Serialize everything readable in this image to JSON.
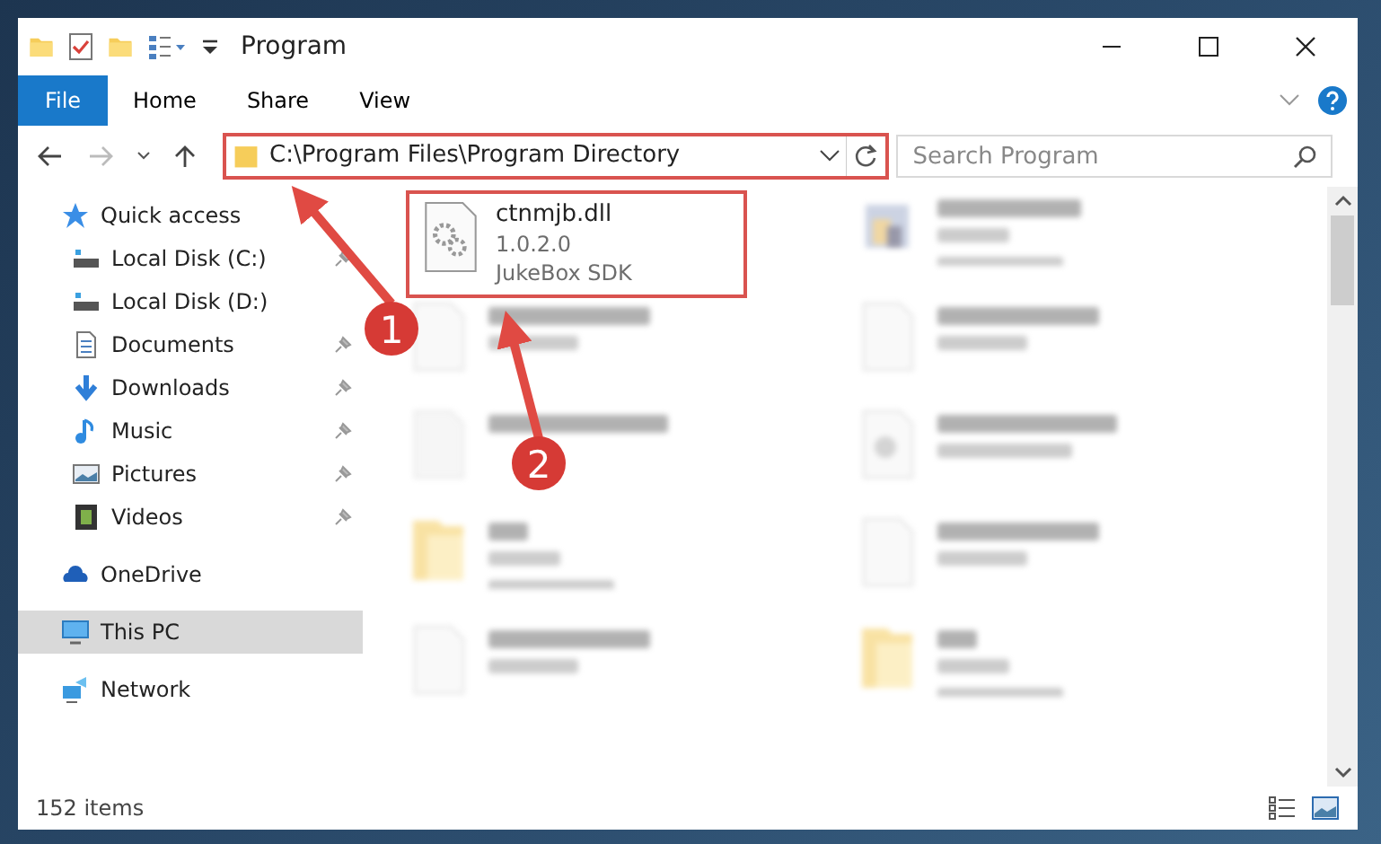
{
  "window": {
    "title": "Program"
  },
  "ribbon": {
    "file_tab": "File",
    "tabs": [
      "Home",
      "Share",
      "View"
    ]
  },
  "address": "C:\\Program Files\\Program Directory",
  "search": {
    "placeholder": "Search Program"
  },
  "sidebar": [
    {
      "label": "Quick access",
      "kind": "star",
      "selected": false,
      "children": [
        {
          "label": "Local Disk (C:)",
          "kind": "drive",
          "pinned": true
        },
        {
          "label": "Local Disk (D:)",
          "kind": "drive",
          "pinned": false
        },
        {
          "label": "Documents",
          "kind": "document",
          "pinned": true
        },
        {
          "label": "Downloads",
          "kind": "download",
          "pinned": true
        },
        {
          "label": "Music",
          "kind": "music",
          "pinned": true
        },
        {
          "label": "Pictures",
          "kind": "pictures",
          "pinned": true
        },
        {
          "label": "Videos",
          "kind": "video",
          "pinned": true
        }
      ]
    },
    {
      "label": "OneDrive",
      "kind": "cloud",
      "selected": false
    },
    {
      "label": "This PC",
      "kind": "pc",
      "selected": true
    },
    {
      "label": "Network",
      "kind": "network",
      "selected": false
    }
  ],
  "files": [
    {
      "kind": "dll",
      "blurred": false,
      "name": "ctnmjb.dll",
      "details": [
        "1.0.2.0",
        "JukeBox SDK"
      ]
    },
    {
      "kind": "exe",
      "blurred": true
    },
    {
      "kind": "file",
      "blurred": true
    },
    {
      "kind": "file",
      "blurred": true
    },
    {
      "kind": "text",
      "blurred": true
    },
    {
      "kind": "resource",
      "blurred": true
    },
    {
      "kind": "folder",
      "blurred": true
    },
    {
      "kind": "file",
      "blurred": true
    },
    {
      "kind": "file",
      "blurred": true
    },
    {
      "kind": "folder",
      "blurred": true
    }
  ],
  "status_bar": "152 items",
  "annotations": [
    {
      "number": "1"
    },
    {
      "number": "2"
    }
  ]
}
